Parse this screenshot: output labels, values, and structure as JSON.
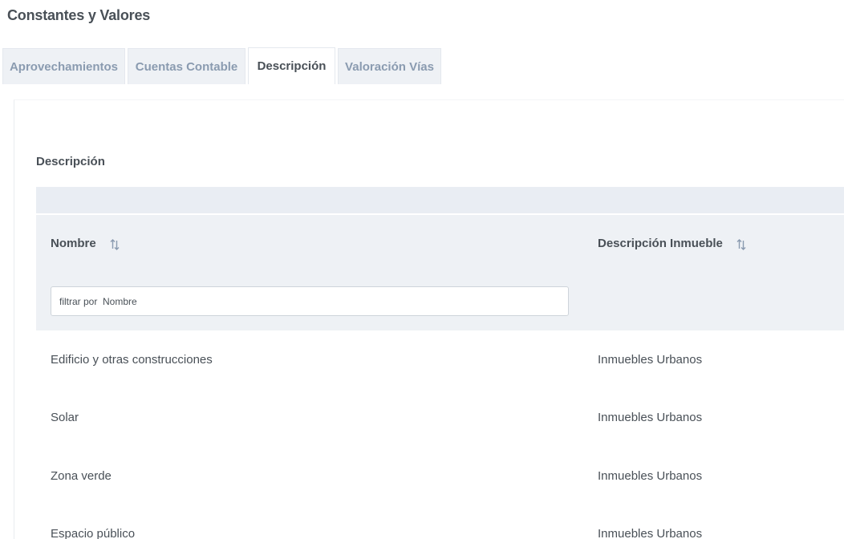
{
  "page": {
    "title": "Constantes y Valores"
  },
  "tabs": [
    {
      "label": "Aprovechamientos",
      "active": false
    },
    {
      "label": "Cuentas Contable",
      "active": false
    },
    {
      "label": "Descripción",
      "active": true
    },
    {
      "label": "Valoración Vías",
      "active": false
    }
  ],
  "section": {
    "title": "Descripción"
  },
  "table": {
    "columns": [
      {
        "label": "Nombre",
        "sortable": true
      },
      {
        "label": "Descripción Inmueble",
        "sortable": true
      }
    ],
    "filter": {
      "placeholder": "filtrar por  Nombre",
      "value": ""
    },
    "rows": [
      {
        "nombre": "Edificio y otras construcciones",
        "descripcion": "Inmuebles Urbanos"
      },
      {
        "nombre": "Solar",
        "descripcion": "Inmuebles Urbanos"
      },
      {
        "nombre": "Zona verde",
        "descripcion": "Inmuebles Urbanos"
      },
      {
        "nombre": "Espacio público",
        "descripcion": "Inmuebles Urbanos"
      }
    ]
  },
  "colors": {
    "tab_text": "#8a9bb0",
    "header_bg": "#eef1f5",
    "text": "#495057"
  },
  "icons": {
    "sort": "sort-icon"
  }
}
